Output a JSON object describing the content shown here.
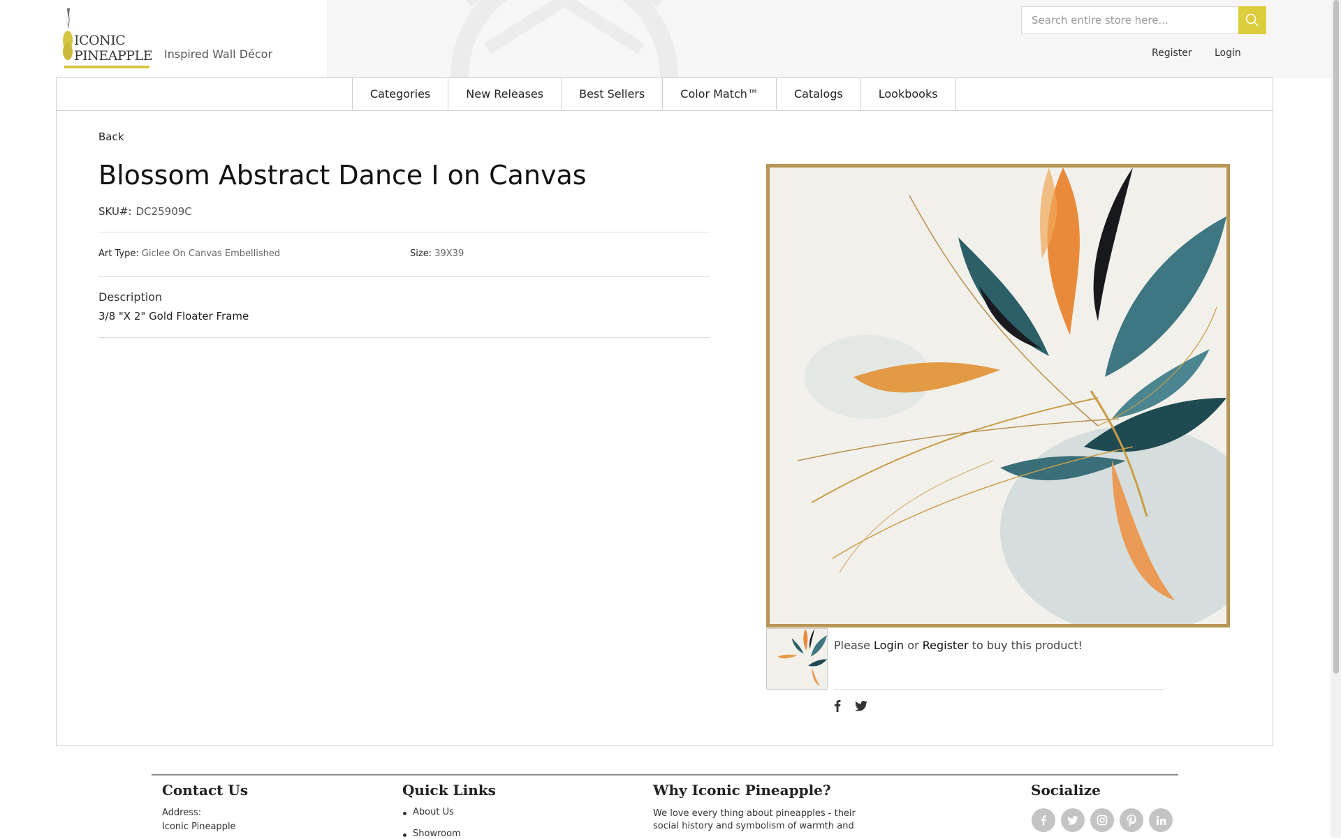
{
  "brand": {
    "logo_line1": "ICONIC",
    "logo_line2": "PINEAPPLE",
    "tagline": "Inspired Wall Décor"
  },
  "header": {
    "search_placeholder": "Search entire store here...",
    "register": "Register",
    "login": "Login"
  },
  "nav": {
    "items": [
      "Categories",
      "New Releases",
      "Best Sellers",
      "Color Match™",
      "Catalogs",
      "Lookbooks"
    ]
  },
  "product": {
    "back": "Back",
    "title": "Blossom Abstract Dance I on Canvas",
    "sku_label": "SKU#:",
    "sku": "DC25909C",
    "art_type_label": "Art Type:",
    "art_type": "Giclee On Canvas Embellished",
    "size_label": "Size:",
    "size": "39X39",
    "description_heading": "Description",
    "description": "3/8 \"X 2\" Gold Floater Frame",
    "buy_prefix": "Please",
    "buy_login": "Login",
    "buy_or": "or",
    "buy_register": "Register",
    "buy_suffix": "to buy this product!"
  },
  "share": [
    "facebook-icon",
    "twitter-icon"
  ],
  "footer": {
    "contact": {
      "heading": "Contact Us",
      "address_label": "Address:",
      "address_line1": "Iconic Pineapple"
    },
    "quick_links": {
      "heading": "Quick Links",
      "items": [
        "About Us",
        "Showroom"
      ]
    },
    "why": {
      "heading": "Why Iconic Pineapple?",
      "text_line1": "We love every thing about pineapples - their",
      "text_line2": "social history and symbolism of warmth and"
    },
    "socialize": {
      "heading": "Socialize",
      "icons": [
        "facebook-icon",
        "twitter-icon",
        "instagram-icon",
        "pinterest-icon",
        "linkedin-icon"
      ]
    }
  },
  "colors": {
    "accent": "#dccd3c",
    "frame_gold": "#b79656"
  }
}
